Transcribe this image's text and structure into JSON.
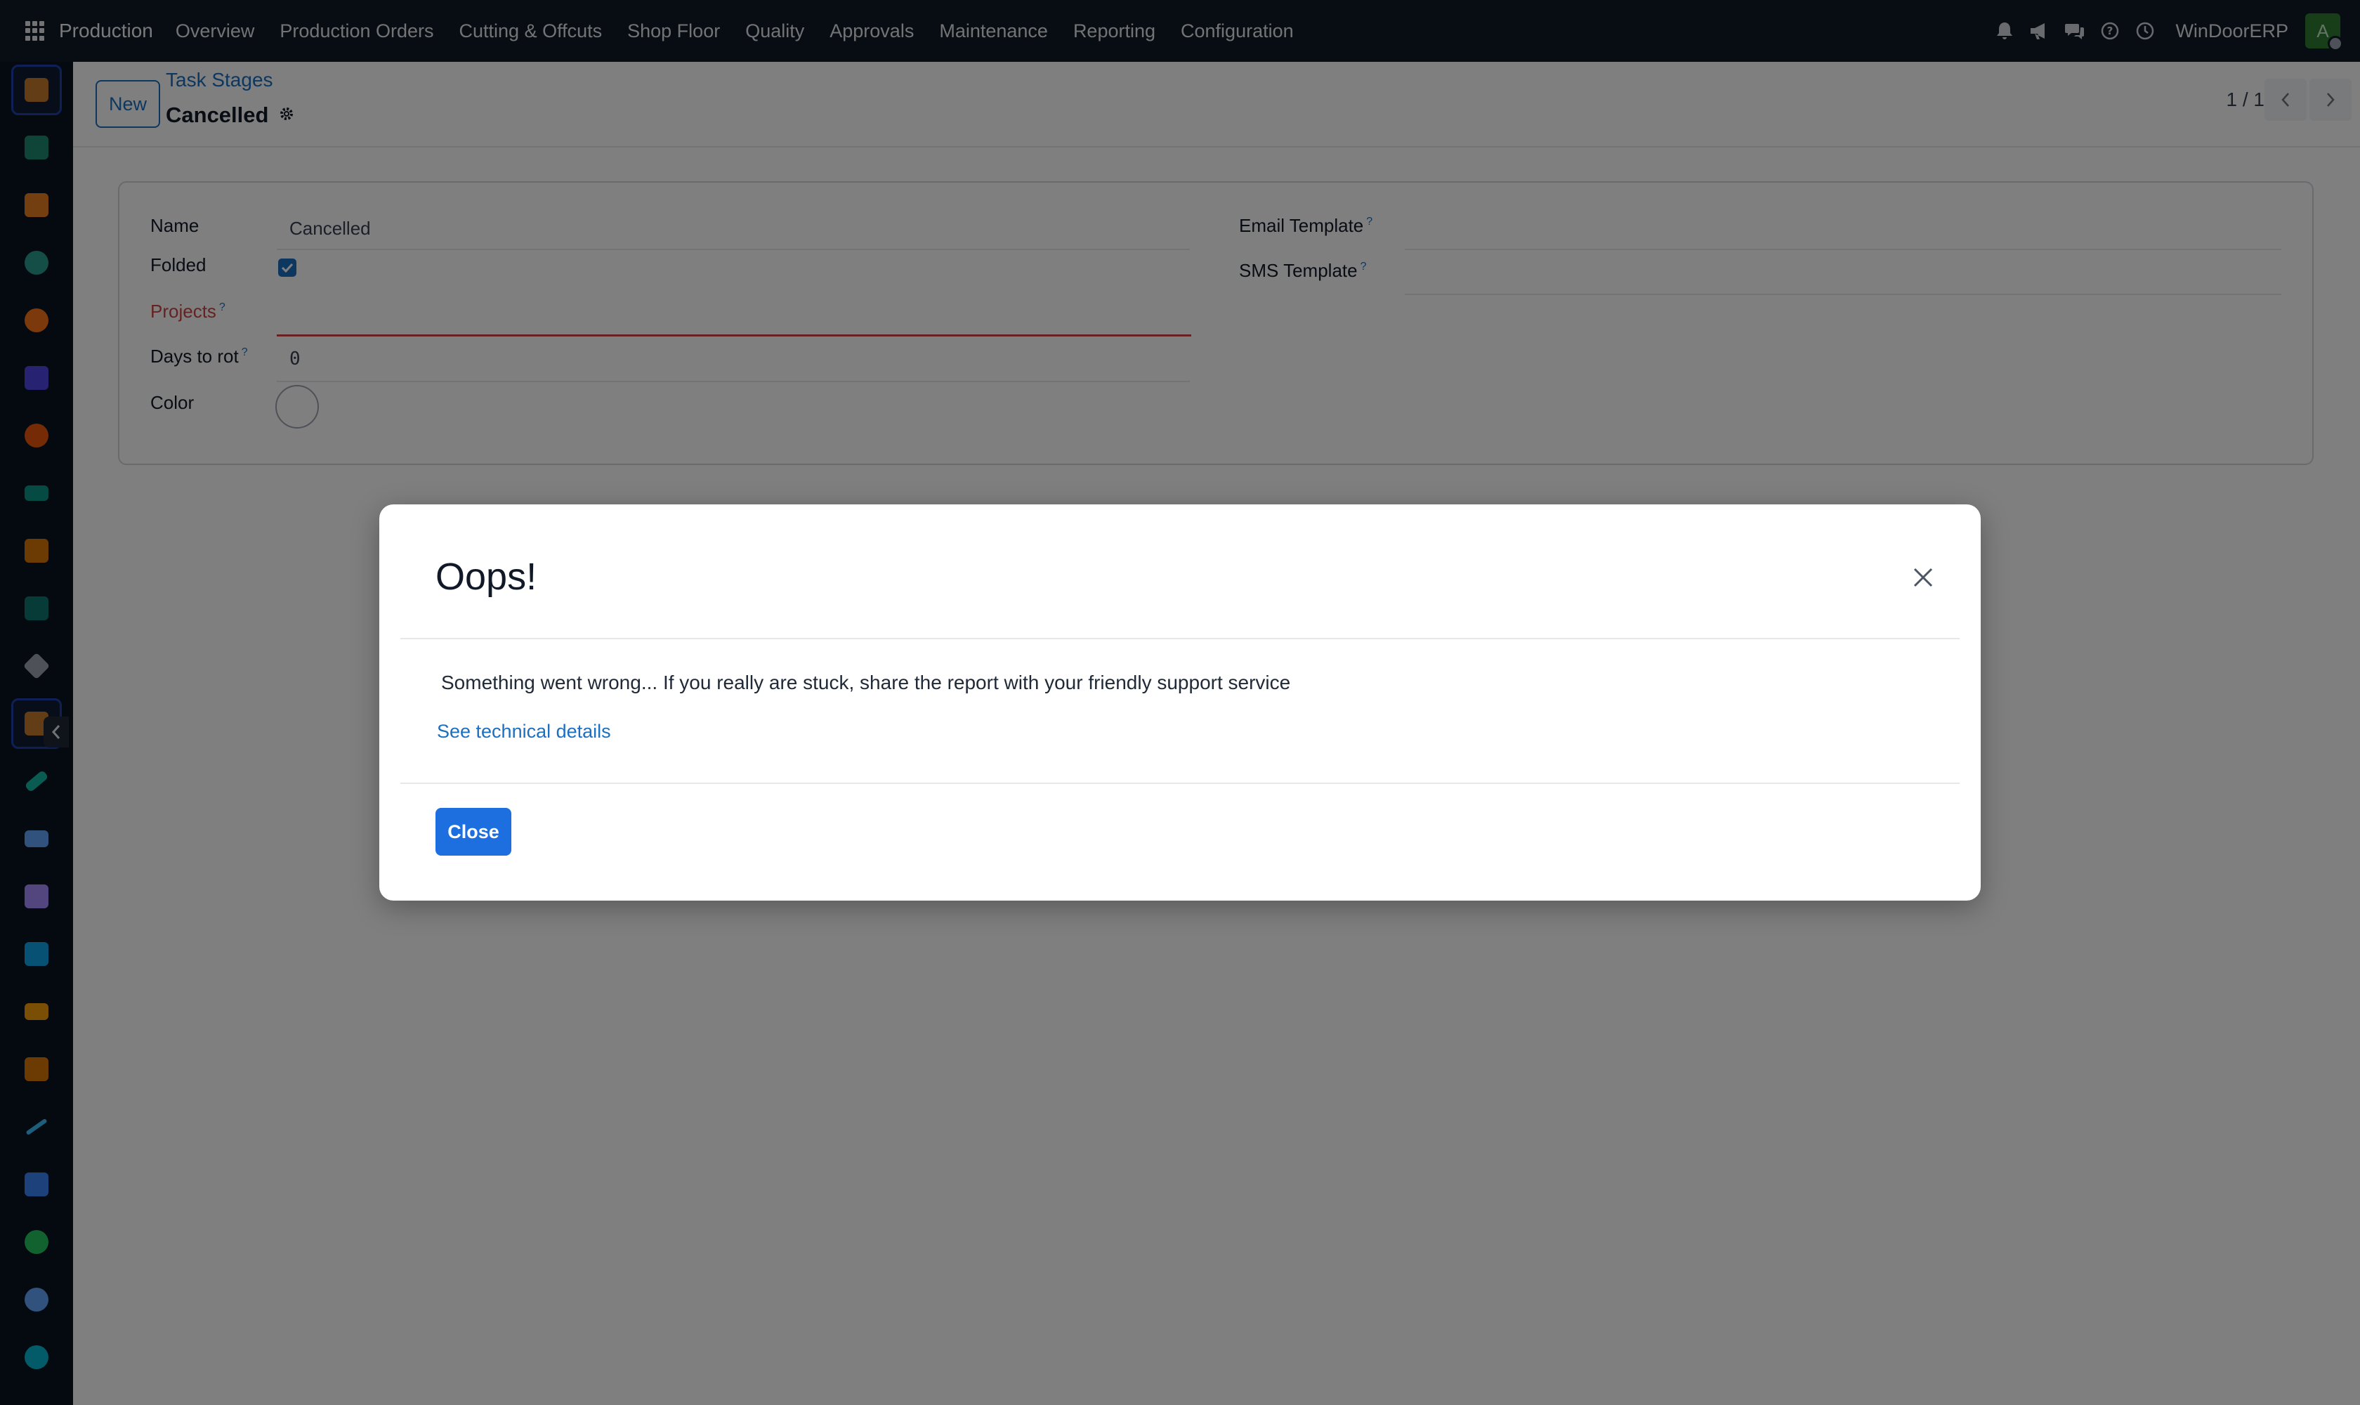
{
  "nav": {
    "brand": "Production",
    "menu": [
      "Overview",
      "Production Orders",
      "Cutting & Offcuts",
      "Shop Floor",
      "Quality",
      "Approvals",
      "Maintenance",
      "Reporting",
      "Configuration"
    ],
    "company": "WinDoorERP",
    "avatar_letter": "A",
    "icons": [
      "bell-icon",
      "megaphone-icon",
      "chat-icon",
      "help-icon",
      "clock-icon"
    ]
  },
  "sidebar": {
    "apps": [
      {
        "name": "app-production-icon",
        "color": "#c47a2c"
      },
      {
        "name": "app-contacts-icon",
        "color": "#1f8a70"
      },
      {
        "name": "app-dashboard-icon",
        "color": "#e67e22"
      },
      {
        "name": "app-pie-chart-icon",
        "color": "#2a9d8f"
      },
      {
        "name": "app-discuss-icon",
        "color": "#f97316"
      },
      {
        "name": "app-mail-icon",
        "color": "#4f46e5"
      },
      {
        "name": "app-livechat-icon",
        "color": "#ea580c"
      },
      {
        "name": "app-inventory-icon",
        "color": "#0d9488"
      },
      {
        "name": "app-reporting-icon",
        "color": "#d97706"
      },
      {
        "name": "app-employees-icon",
        "color": "#0f766e"
      },
      {
        "name": "app-box-icon",
        "color": "#9ca3af"
      },
      {
        "name": "app-project-icon",
        "color": "#c47a2c"
      },
      {
        "name": "app-tasks-icon",
        "color": "#14b8a6"
      },
      {
        "name": "app-knowledge-icon",
        "color": "#60a5fa"
      },
      {
        "name": "app-package-icon",
        "color": "#a78bfa"
      },
      {
        "name": "app-documents-icon",
        "color": "#0ea5e9"
      },
      {
        "name": "app-team-icon",
        "color": "#f59e0b"
      },
      {
        "name": "app-calendar-icon",
        "color": "#d97706"
      },
      {
        "name": "app-sign-icon",
        "color": "#38bdf8"
      },
      {
        "name": "app-grid-icon",
        "color": "#3b82f6"
      },
      {
        "name": "app-whatsapp-icon",
        "color": "#22c55e"
      },
      {
        "name": "app-compass-icon",
        "color": "#60a5fa"
      },
      {
        "name": "app-globe-icon",
        "color": "#06b6d4"
      }
    ]
  },
  "control": {
    "new_label": "New",
    "breadcrumb": "Task Stages",
    "title": "Cancelled",
    "pager": "1 / 1"
  },
  "form": {
    "name_label": "Name",
    "name_value": "Cancelled",
    "folded_label": "Folded",
    "folded_checked": true,
    "projects_label": "Projects",
    "days_label": "Days to rot",
    "days_value": "0",
    "color_label": "Color",
    "email_template_label": "Email Template",
    "sms_template_label": "SMS Template",
    "help_mark": "?"
  },
  "dialog": {
    "title": "Oops!",
    "message": "Something went wrong... If you really are stuck, share the report with your friendly support service",
    "details_link": "See technical details",
    "close_label": "Close"
  },
  "colors": {
    "topbar": "#111827",
    "primary": "#1d6fbf",
    "button_primary": "#1d6fe0",
    "error": "#d14343"
  }
}
